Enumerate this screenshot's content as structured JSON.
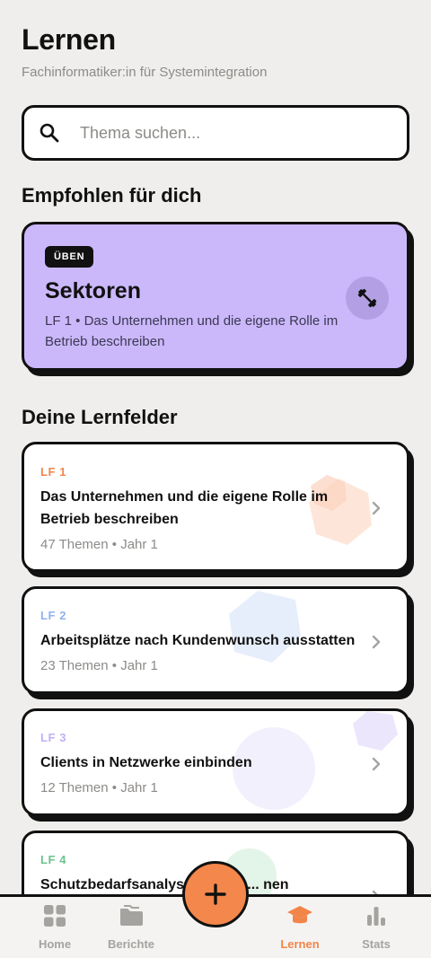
{
  "header": {
    "title": "Lernen",
    "subtitle": "Fachinformatiker:in für Systemintegration"
  },
  "search": {
    "placeholder": "Thema suchen...",
    "value": ""
  },
  "recommended": {
    "heading": "Empfohlen für dich",
    "badge": "ÜBEN",
    "title": "Sektoren",
    "description": "LF 1 • Das Unternehmen und die eigene Rolle im Betrieb beschreiben",
    "icon": "dumbbell-icon",
    "color": "#cbb8fb"
  },
  "fields": {
    "heading": "Deine Lernfelder",
    "items": [
      {
        "code": "LF 1",
        "title": "Das Unternehmen und die eigene Rolle im Betrieb beschreiben",
        "meta": "47 Themen • Jahr 1",
        "color": "#f2854a"
      },
      {
        "code": "LF 2",
        "title": "Arbeitsplätze nach Kundenwunsch ausstatten",
        "meta": "23 Themen • Jahr 1",
        "color": "#8fb2ea"
      },
      {
        "code": "LF 3",
        "title": "Clients in Netzwerke einbinden",
        "meta": "12 Themen • Jahr 1",
        "color": "#c2b1f5"
      },
      {
        "code": "LF 4",
        "title": "Schutzbedarfsanalyse im Netz... nen",
        "meta": "",
        "color": "#6cc38d"
      }
    ]
  },
  "nav": {
    "items": [
      {
        "label": "Home",
        "icon": "grid-icon",
        "active": false
      },
      {
        "label": "Berichte",
        "icon": "folder-icon",
        "active": false
      },
      {
        "label": "Lernen",
        "icon": "graduation-cap-icon",
        "active": true
      },
      {
        "label": "Stats",
        "icon": "bar-chart-icon",
        "active": false
      }
    ],
    "fab_icon": "plus-icon"
  },
  "colors": {
    "background": "#efeeec",
    "accent": "#f2854a",
    "border": "#111111"
  }
}
